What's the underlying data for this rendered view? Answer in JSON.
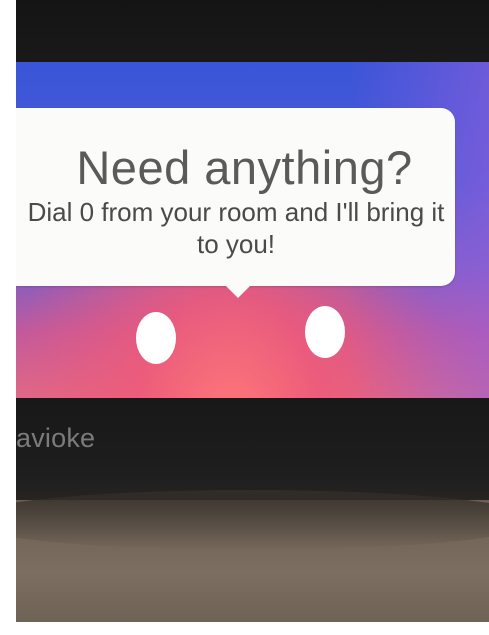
{
  "message": {
    "headline": "Need anything?",
    "body": "Dial 0 from your room and I'll bring it to you!"
  },
  "brand": {
    "name": "avioke"
  },
  "colors": {
    "screen_top": "#3a55d8",
    "screen_bottom": "#e06a86",
    "bubble": "#fbfbfa",
    "text": "#5a5a5a"
  }
}
